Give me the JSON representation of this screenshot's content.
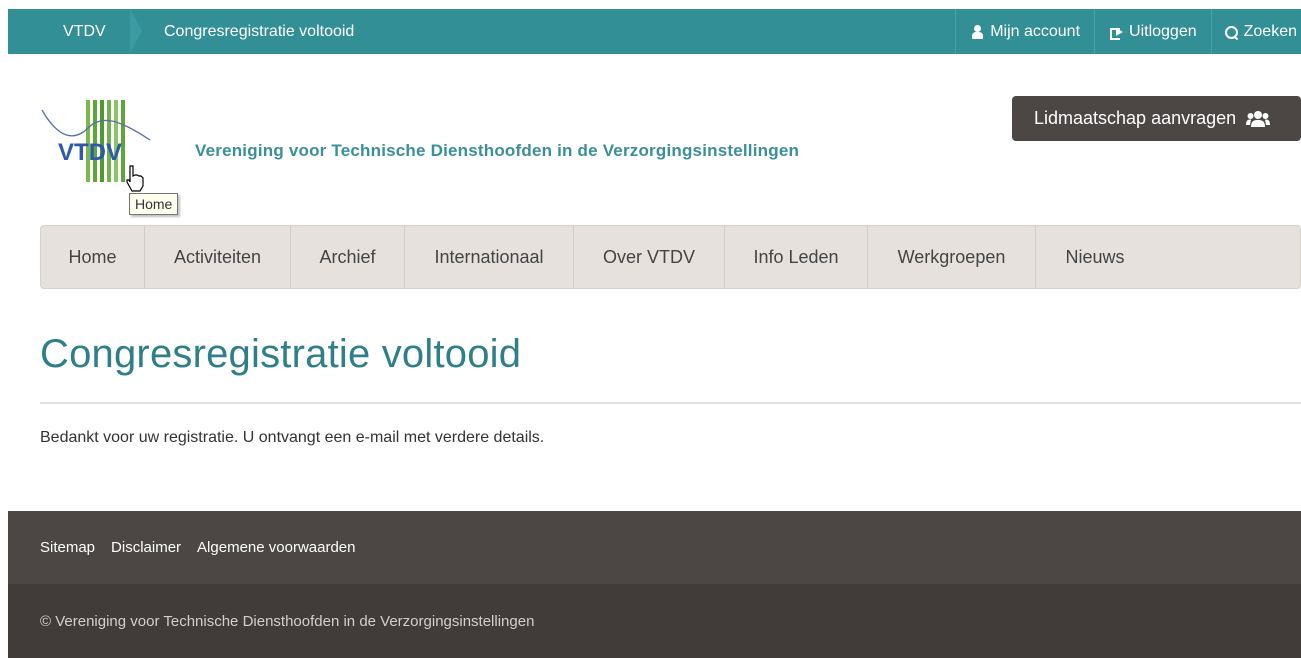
{
  "colors": {
    "topbar": "#338f96",
    "accent_text": "#3a8f9a",
    "title": "#2f7f89",
    "nav_bg": "#e6e1dd",
    "button_dark": "#4c4644",
    "footer_top": "#4c4644",
    "footer_bottom": "#413b39"
  },
  "topbar": {
    "breadcrumb_home": "VTDV",
    "breadcrumb_current": "Congresregistratie voltooid",
    "nav": [
      {
        "label": "Mijn account",
        "icon": "user-icon"
      },
      {
        "label": "Uitloggen",
        "icon": "logout-icon"
      },
      {
        "label": "Zoeken",
        "icon": "search-icon"
      }
    ]
  },
  "header": {
    "logo_text": "VTDV",
    "tagline": "Vereniging voor Technische Diensthoofden in de Verzorgingsinstellingen",
    "tooltip": "Home",
    "member_button": "Lidmaatschap aanvragen"
  },
  "mainnav": [
    "Home",
    "Activiteiten",
    "Archief",
    "Internationaal",
    "Over VTDV",
    "Info Leden",
    "Werkgroepen",
    "Nieuws"
  ],
  "content": {
    "title": "Congresregistratie voltooid",
    "message": "Bedankt voor uw registratie. U ontvangt een e-mail met verdere details."
  },
  "footer": {
    "links": [
      "Sitemap",
      "Disclaimer",
      "Algemene voorwaarden"
    ],
    "copyright": "© Vereniging voor Technische Diensthoofden in de Verzorgingsinstellingen"
  }
}
